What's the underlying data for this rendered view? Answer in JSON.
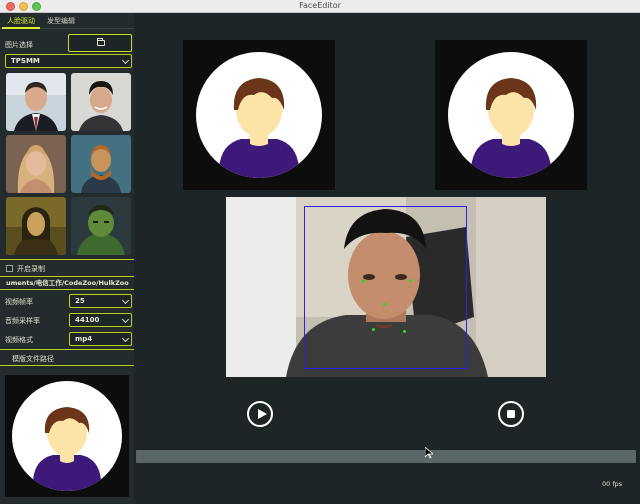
{
  "window": {
    "title": "FaceEditor"
  },
  "tabs": [
    {
      "label": "人脸驱动",
      "active": true
    },
    {
      "label": "发型编辑",
      "active": false
    }
  ],
  "sidebar": {
    "image_select_label": "图片选择",
    "model_select": {
      "value": "TPSMM"
    },
    "record_label": "开启录制",
    "path_value": "uments/电信工作/CodeZoo/HulkZoo",
    "fps_label": "视频帧率",
    "fps_value": "25",
    "sample_rate_label": "音频采样率",
    "sample_rate_value": "44100",
    "format_label": "视频格式",
    "format_value": "mp4",
    "template_label": "模版文件路径"
  },
  "footer": {
    "fps_readout": "00 fps"
  },
  "colors": {
    "accent": "#d8ee28",
    "background": "#1e2527",
    "bbox": "#2a22e8",
    "landmark": "#22dd22"
  }
}
